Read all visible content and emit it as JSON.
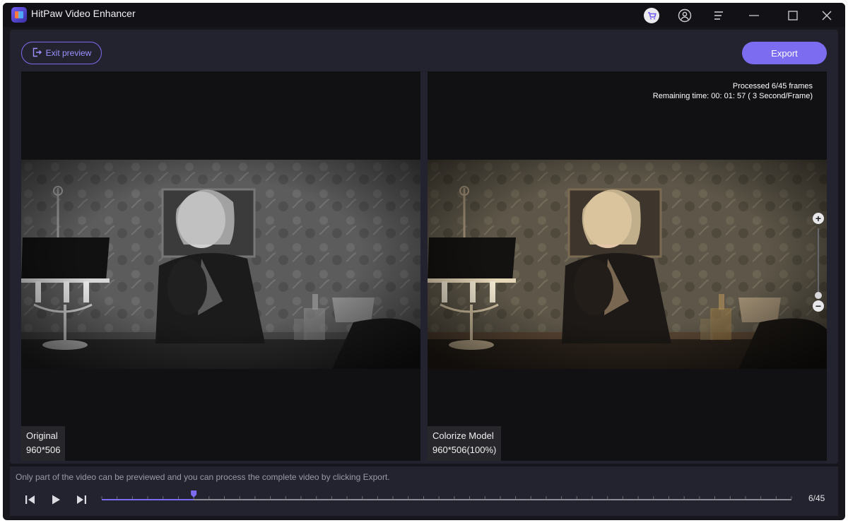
{
  "app": {
    "title": "HitPaw Video Enhancer"
  },
  "titlebar_icons": [
    "cart-icon",
    "user-icon",
    "menu-icon",
    "minimize-icon",
    "maximize-icon",
    "close-icon"
  ],
  "toolbar": {
    "exit_label": "Exit preview",
    "export_label": "Export"
  },
  "original": {
    "name": "Original",
    "resolution": "960*506"
  },
  "processed": {
    "name": "Colorize Model",
    "resolution": "960*506(100%)",
    "processed_text": "Processed 6/45 frames",
    "remaining_text": "Remaining time: 00: 01: 57 ( 3 Second/Frame)"
  },
  "zoom": {
    "plus": "+",
    "minus": "−"
  },
  "footer": {
    "hint": "Only part of the video can be previewed and you can process the complete video by clicking Export.",
    "counter": "6/45"
  },
  "timeline": {
    "current_frame": 6,
    "total_frames": 45
  },
  "colors": {
    "accent": "#7b6cf0",
    "background": "#16161c",
    "panel": "#232330",
    "pane": "#111113"
  }
}
